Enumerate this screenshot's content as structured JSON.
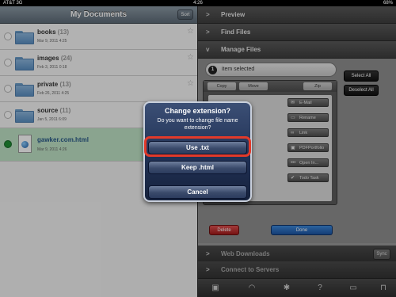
{
  "status": {
    "carrier": "AT&T  3G",
    "clock": "4:26",
    "battery": "68%"
  },
  "left": {
    "title": "My Documents",
    "sort_label": "Sort",
    "items": [
      {
        "name": "books",
        "count": "(13)",
        "date": "Mar 9, 2011 4:25"
      },
      {
        "name": "images",
        "count": "(24)",
        "date": "Feb 3, 2011 0:18"
      },
      {
        "name": "private",
        "count": "(13)",
        "date": "Feb 26, 2011 4:25"
      },
      {
        "name": "source",
        "count": "(11)",
        "date": "Jan 5, 2011 6:09"
      },
      {
        "name": "gawker.com.html",
        "date": "Mar 9, 2011 4:26"
      }
    ]
  },
  "right": {
    "sections": {
      "preview": "Preview",
      "find": "Find Files",
      "manage": "Manage Files",
      "web": "Web Downloads",
      "servers": "Connect to Servers"
    },
    "sync_label": "Sync",
    "selection": {
      "count": "1",
      "text": "item selected"
    },
    "select_all": "Select All",
    "deselect_all": "Deselect All",
    "tabs": [
      "Copy",
      "Move",
      "Zip"
    ],
    "tools": [
      {
        "icon": "mail-icon",
        "glyph": "✉",
        "label": "E-Mail"
      },
      {
        "icon": "rename-icon",
        "glyph": "▭",
        "label": "Rename"
      },
      {
        "icon": "link-icon",
        "glyph": "∞",
        "label": "Link"
      },
      {
        "icon": "pdf-icon",
        "glyph": "▣",
        "label": "PDFPortfolio"
      },
      {
        "icon": "more-icon",
        "glyph": "•••",
        "label": "Open In..."
      },
      {
        "icon": "check-icon",
        "glyph": "✔",
        "label": "Todo Task"
      }
    ],
    "delete_label": "Delete",
    "done_label": "Done"
  },
  "dialog": {
    "title": "Change extension?",
    "message": "Do you want to change file name extension?",
    "buttons": [
      "Use .txt",
      "Keep .html",
      "Cancel"
    ]
  },
  "colors": {
    "accent_highlight": "#e23a2a",
    "selected_row": "#bfe4c6",
    "dialog_bg": "#1f2f52"
  }
}
